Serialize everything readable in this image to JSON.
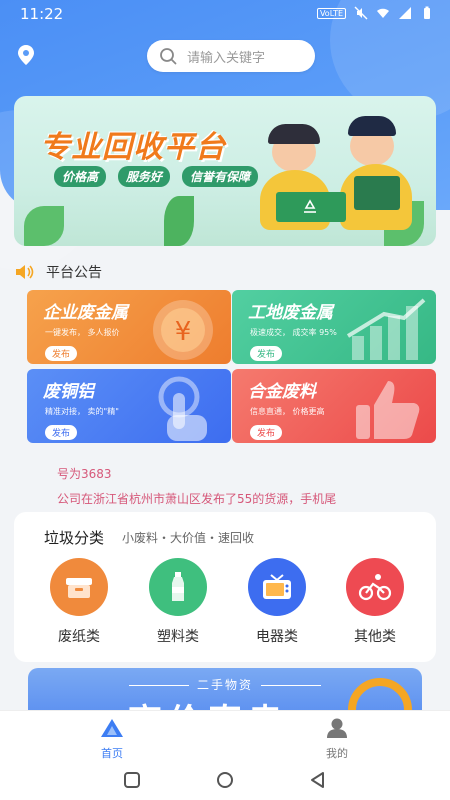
{
  "status_bar": {
    "time": "11:22",
    "network_badge": "VoLTE"
  },
  "header": {
    "search_placeholder": "请输入关键字"
  },
  "banner": {
    "title": "专业回收平台",
    "tags": [
      "价格高",
      "服务好",
      "信誉有保障"
    ]
  },
  "announcement": {
    "title": "平台公告"
  },
  "categories": [
    {
      "title": "企业废金属",
      "desc": "一键发布， 多人报价",
      "button": "发布"
    },
    {
      "title": "工地废金属",
      "desc": "极速成交， 成交率 95%",
      "button": "发布"
    },
    {
      "title": "废铜铝",
      "desc": "精准对接， 卖的\"精\"",
      "button": "发布"
    },
    {
      "title": "合金废料",
      "desc": "信息直通， 价格更高",
      "button": "发布"
    }
  ],
  "ticker": {
    "line1": "号为3683",
    "line2": "公司在浙江省杭州市萧山区发布了55的货源，手机尾"
  },
  "garbage": {
    "title": "垃圾分类",
    "subtitle": "小废料・大价值・速回收",
    "items": [
      {
        "label": "废纸类",
        "color": "#f08a3c",
        "icon": "box-icon"
      },
      {
        "label": "塑料类",
        "color": "#3fbf7e",
        "icon": "bottle-icon"
      },
      {
        "label": "电器类",
        "color": "#3d6df0",
        "icon": "tv-icon"
      },
      {
        "label": "其他类",
        "color": "#ee4a52",
        "icon": "cyclist-icon"
      }
    ]
  },
  "banner2": {
    "caption": "二手物资",
    "big_text": "高价直卖"
  },
  "tabbar": {
    "home": "首页",
    "mine": "我的"
  },
  "colors": {
    "primary": "#3d7df3",
    "accent": "#f07a1c"
  }
}
